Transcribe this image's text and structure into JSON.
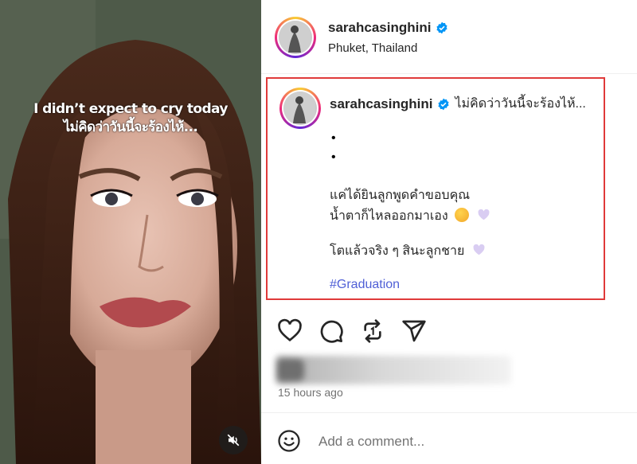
{
  "media": {
    "caption_line1": "I didn’t expect to cry today",
    "caption_line2": "ไม่คิดว่าวันนี้จะร้องไห้...",
    "mute_icon": "speaker-muted-icon"
  },
  "header": {
    "username": "sarahcasinghini",
    "location": "Phuket, Thailand",
    "verified": true
  },
  "caption": {
    "username": "sarahcasinghini",
    "first_line": "ไม่คิดว่าวันนี้จะร้องไห้...",
    "bullet1": "•",
    "bullet2": "•",
    "line1": "แค่ได้ยินลูกพูดคำขอบคุณ",
    "line2": "น้ำตาก็ไหลออกมาเอง",
    "line3": "โตแล้วจริง ๆ สินะลูกชาย",
    "hashtag": "#Graduation"
  },
  "actions": {
    "like_icon": "heart-icon",
    "comment_icon": "comment-icon",
    "repost_icon": "repost-icon",
    "share_icon": "share-icon"
  },
  "meta": {
    "timestamp": "15 hours ago"
  },
  "comment": {
    "placeholder": "Add a comment..."
  },
  "colors": {
    "highlight_border": "#e03a3a",
    "verified_blue": "#0095f6",
    "hashtag": "#4f5fd6"
  }
}
